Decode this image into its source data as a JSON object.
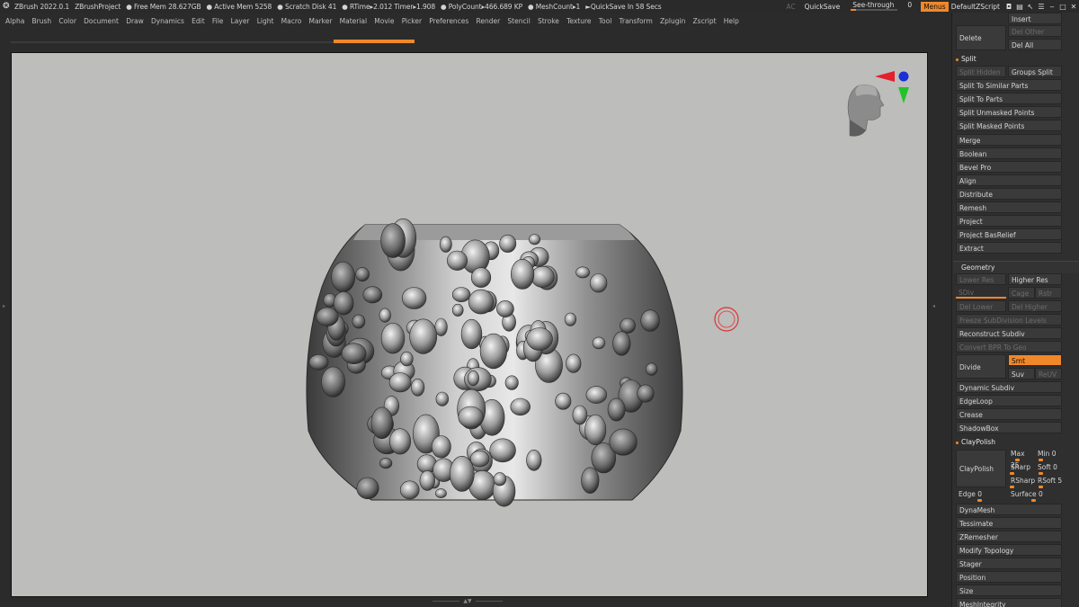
{
  "titlebar": {
    "app": "ZBrush 2022.0.1",
    "project": "ZBrushProject",
    "free_mem": "● Free Mem 28.627GB",
    "active_mem": "● Active Mem 5258",
    "scratch": "● Scratch Disk 41",
    "timers": "● RTime▸2.012 Timer▸1.908",
    "polycount": "● PolyCount▸466.689 KP",
    "meshcount": "● MeshCount▸1",
    "quicksave_in": "►QuickSave In 58 Secs",
    "ac": "AC",
    "quicksave": "QuickSave",
    "seethrough_label": "See-through",
    "seethrough_value": "0",
    "seethrough_level": 0.0,
    "menus": "Menus",
    "defaultzscript": "DefaultZScript"
  },
  "menubar": [
    "Alpha",
    "Brush",
    "Color",
    "Document",
    "Draw",
    "Dynamics",
    "Edit",
    "File",
    "Layer",
    "Light",
    "Macro",
    "Marker",
    "Material",
    "Movie",
    "Picker",
    "Preferences",
    "Render",
    "Stencil",
    "Stroke",
    "Texture",
    "Tool",
    "Transform",
    "Zplugin",
    "Zscript",
    "Help"
  ],
  "panel": {
    "insert": "Insert",
    "delete": "Delete",
    "del_other": "Del Other",
    "del_all": "Del All",
    "split": "Split",
    "split_hidden": "Split Hidden",
    "groups_split": "Groups Split",
    "split_similar": "Split To Similar Parts",
    "split_parts": "Split To Parts",
    "split_unmasked": "Split Unmasked Points",
    "split_masked": "Split Masked Points",
    "merge": "Merge",
    "boolean": "Boolean",
    "bevel_pro": "Bevel Pro",
    "align": "Align",
    "distribute": "Distribute",
    "remesh": "Remesh",
    "project": "Project",
    "project_basrelief": "Project BasRelief",
    "extract": "Extract",
    "geometry": "Geometry",
    "lower_res": "Lower Res",
    "higher_res": "Higher Res",
    "sdiv": "SDiv",
    "cage": "Cage",
    "rstr": "Rstr",
    "del_lower": "Del Lower",
    "del_higher": "Del Higher",
    "freeze": "Freeze SubDivision Levels",
    "reconstruct": "Reconstruct Subdiv",
    "convert_bpr": "Convert BPR To Geo",
    "divide": "Divide",
    "smt": "Smt",
    "suv": "Suv",
    "reuv": "ReUV",
    "dynamic_subdiv": "Dynamic Subdiv",
    "edgeloop": "EdgeLoop",
    "crease": "Crease",
    "shadowbox": "ShadowBox",
    "claypolish_hdr": "ClayPolish",
    "claypolish": "ClayPolish",
    "max": "Max 25",
    "min": "Min 0",
    "sharp": "Sharp",
    "soft": "Soft 0",
    "rsharp": "RSharp",
    "rsoft": "RSoft 5",
    "edge": "Edge 0",
    "surface": "Surface 0",
    "dynamesh": "DynaMesh",
    "tessimate": "Tessimate",
    "zremesher": "ZRemesher",
    "modify_topology": "Modify Topology",
    "stager": "Stager",
    "position": "Position",
    "size": "Size",
    "meshintegrity": "MeshIntegrity"
  },
  "colors": {
    "accent": "#f0882a",
    "canvas": "#bdbdbb",
    "panel": "#2f2f2f"
  },
  "viewport": {
    "model": "sculpted cylindrical band with figures",
    "navigator": "head-orientation-gizmo"
  }
}
